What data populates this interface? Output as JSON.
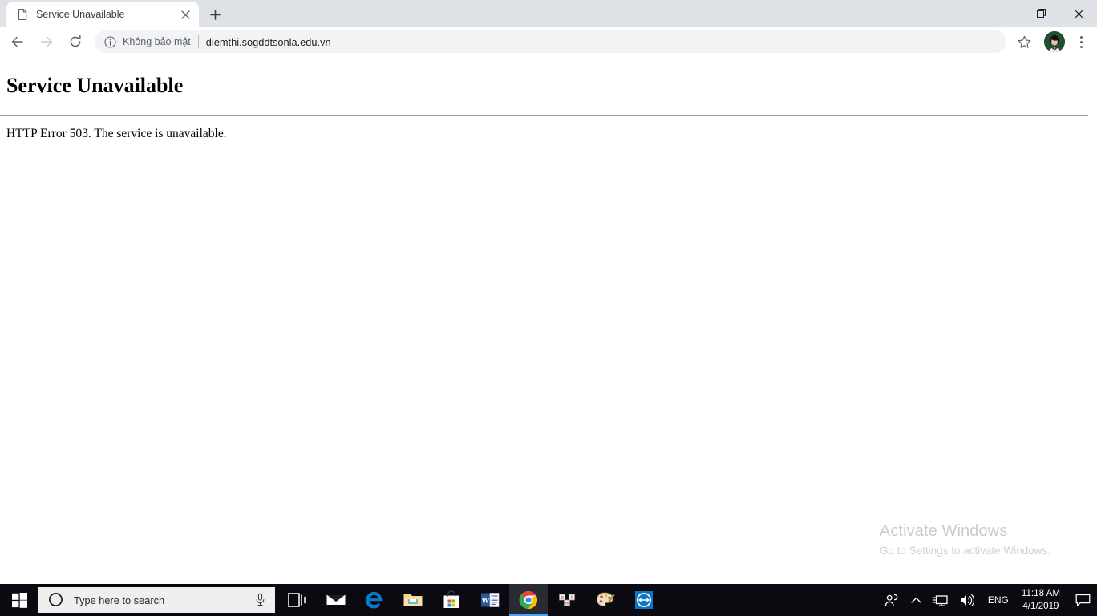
{
  "browser": {
    "tab": {
      "title": "Service Unavailable",
      "favicon_name": "page-document-icon",
      "close_label": "×"
    },
    "new_tab_label": "+",
    "window_controls": {
      "minimize": "—",
      "restore": "❐",
      "close": "✕"
    },
    "toolbar": {
      "back_icon": "back-arrow-icon",
      "forward_icon": "forward-arrow-icon",
      "reload_icon": "reload-icon",
      "security_icon": "info-circle-icon",
      "security_text": "Không bảo mật",
      "url": "diemthi.sogddtsonla.edu.vn",
      "bookmark_icon": "star-icon",
      "avatar_name": "profile-avatar",
      "menu_icon": "three-dot-menu-icon"
    }
  },
  "page": {
    "heading": "Service Unavailable",
    "body_text": "HTTP Error 503. The service is unavailable."
  },
  "watermark": {
    "title": "Activate Windows",
    "subtitle": "Go to Settings to activate Windows."
  },
  "taskbar": {
    "start_label": "windows-logo-icon",
    "search": {
      "placeholder": "Type here to search",
      "cortana_icon": "cortana-circle-icon",
      "mic_icon": "microphone-icon"
    },
    "items": [
      {
        "name": "task-view",
        "label": "Task View",
        "active": false
      },
      {
        "name": "mail",
        "label": "Mail",
        "active": false
      },
      {
        "name": "microsoft-edge",
        "label": "Microsoft Edge",
        "active": false
      },
      {
        "name": "file-explorer",
        "label": "File Explorer",
        "active": false
      },
      {
        "name": "microsoft-store",
        "label": "Microsoft Store",
        "active": false
      },
      {
        "name": "microsoft-word",
        "label": "Microsoft Word",
        "active": false
      },
      {
        "name": "google-chrome",
        "label": "Google Chrome",
        "active": true
      },
      {
        "name": "unikey",
        "label": "UniKey",
        "active": false
      },
      {
        "name": "paint",
        "label": "Paint",
        "active": false
      },
      {
        "name": "teamviewer",
        "label": "TeamViewer",
        "active": false
      }
    ],
    "tray": {
      "people_icon": "people-icon",
      "chevron_icon": "chevron-up-icon",
      "network_icon": "network-monitor-icon",
      "volume_icon": "volume-icon",
      "language": "ENG",
      "time": "11:18 AM",
      "date": "4/1/2019",
      "notification_icon": "notification-center-icon"
    }
  },
  "colors": {
    "tabstrip_bg": "#dee1e6",
    "omnibox_bg": "#f1f3f4",
    "taskbar_bg": "#0a0a10",
    "chrome_active_underline": "#4ba3f2",
    "page_text": "#000000"
  }
}
